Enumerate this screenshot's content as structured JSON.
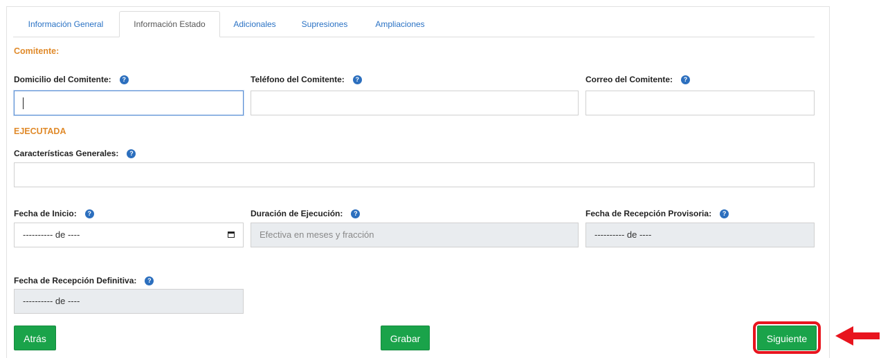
{
  "tabs": [
    {
      "label": "Información General",
      "active": false
    },
    {
      "label": "Información Estado",
      "active": true
    },
    {
      "label": "Adicionales",
      "active": false
    },
    {
      "label": "Supresiones",
      "active": false
    },
    {
      "label": "Ampliaciones",
      "active": false
    }
  ],
  "sections": {
    "comitente": "Comitente:",
    "ejecutada": "EJECUTADA"
  },
  "fields": {
    "domicilio": {
      "label": "Domicilio del Comitente:",
      "value": ""
    },
    "telefono": {
      "label": "Teléfono del Comitente:",
      "value": ""
    },
    "correo": {
      "label": "Correo del Comitente:",
      "value": ""
    },
    "caracteristicas": {
      "label": "Características Generales:",
      "value": ""
    },
    "fecha_inicio": {
      "label": "Fecha de Inicio:",
      "value": "---------- de ----"
    },
    "duracion": {
      "label": "Duración de Ejecución:",
      "placeholder": "Efectiva en meses y fracción"
    },
    "fecha_provisoria": {
      "label": "Fecha de Recepción Provisoria:",
      "value": "---------- de ----"
    },
    "fecha_definitiva": {
      "label": "Fecha de Recepción Definitiva:",
      "value": "---------- de ----"
    }
  },
  "help_glyph": "?",
  "buttons": {
    "back": "Atrás",
    "save": "Grabar",
    "next": "Siguiente"
  },
  "colors": {
    "accent_green": "#1aa34a",
    "section_orange": "#e08a2a",
    "tab_blue": "#2a72c4",
    "annotation_red": "#e8141e"
  }
}
